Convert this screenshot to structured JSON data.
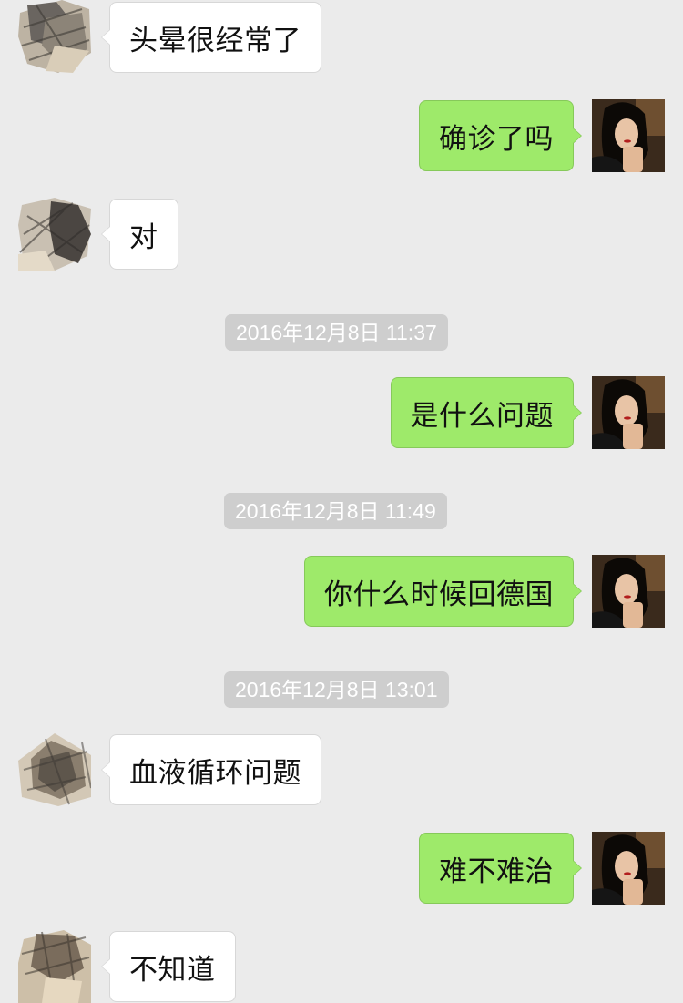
{
  "chat": {
    "messages": [
      {
        "direction": "incoming",
        "text": "头晕很经常了"
      },
      {
        "direction": "outgoing",
        "text": "确诊了吗"
      },
      {
        "direction": "incoming",
        "text": "对"
      },
      {
        "type": "timestamp",
        "text": "2016年12月8日 11:37"
      },
      {
        "direction": "outgoing",
        "text": "是什么问题"
      },
      {
        "type": "timestamp",
        "text": "2016年12月8日 11:49"
      },
      {
        "direction": "outgoing",
        "text": "你什么时候回德国"
      },
      {
        "type": "timestamp",
        "text": "2016年12月8日 13:01"
      },
      {
        "direction": "incoming",
        "text": "血液循环问题"
      },
      {
        "direction": "outgoing",
        "text": "难不难治"
      },
      {
        "direction": "incoming",
        "text": "不知道"
      }
    ]
  },
  "colors": {
    "background": "#ebebeb",
    "incoming_bubble": "#ffffff",
    "outgoing_bubble": "#9eea6a",
    "timestamp_bg": "#cecece",
    "timestamp_text": "#ffffff"
  },
  "icons": {
    "contact_avatar": "sketch-avatar-icon",
    "self_avatar": "user-photo-avatar"
  }
}
